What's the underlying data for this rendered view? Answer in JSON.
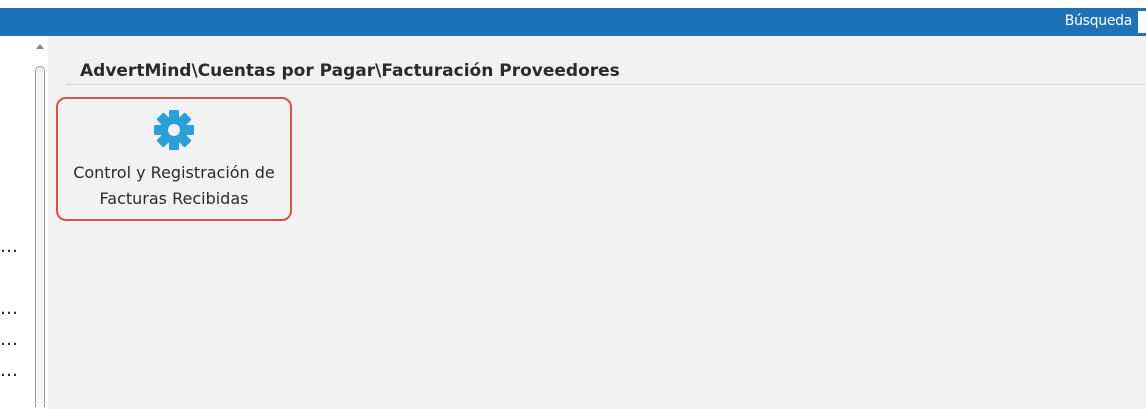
{
  "header": {
    "search_label": "Búsqueda"
  },
  "main": {
    "breadcrumb": "AdvertMind\\Cuentas por Pagar\\Facturación Proveedores",
    "tiles": [
      {
        "icon": "gear-icon",
        "label_line1": "Control y Registración de",
        "label_line2": "Facturas Recibidas"
      }
    ]
  },
  "left_panel": {
    "truncated_items": [
      "…",
      "…",
      "…",
      "…"
    ]
  },
  "colors": {
    "topbar": "#1e73b8",
    "tile_border": "#d9534a",
    "gear": "#2a9fd8",
    "content_bg": "#f2f2f2"
  }
}
